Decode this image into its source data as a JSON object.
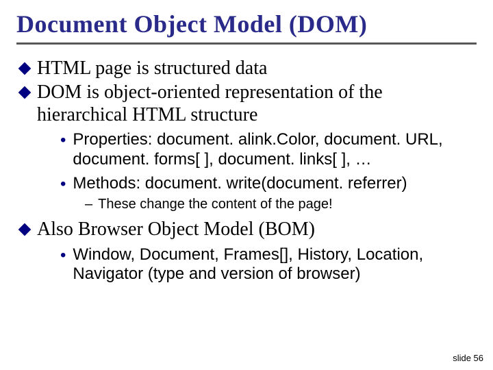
{
  "title": "Document Object Model (DOM)",
  "root": {
    "b1": "HTML page is structured data",
    "b2": "DOM is object-oriented representation of the hierarchical HTML structure",
    "b3": "Also Browser Object Model (BOM)"
  },
  "sub": {
    "s1": "Properties:  document. alink.Color, document. URL, document. forms[ ], document. links[ ], …",
    "s2": "Methods:  document. write(document. referrer)",
    "s3": "Window, Document, Frames[], History, Location, Navigator (type and version of browser)"
  },
  "dash": {
    "d1": "These change the content of the page!"
  },
  "slide_number": "slide 56"
}
